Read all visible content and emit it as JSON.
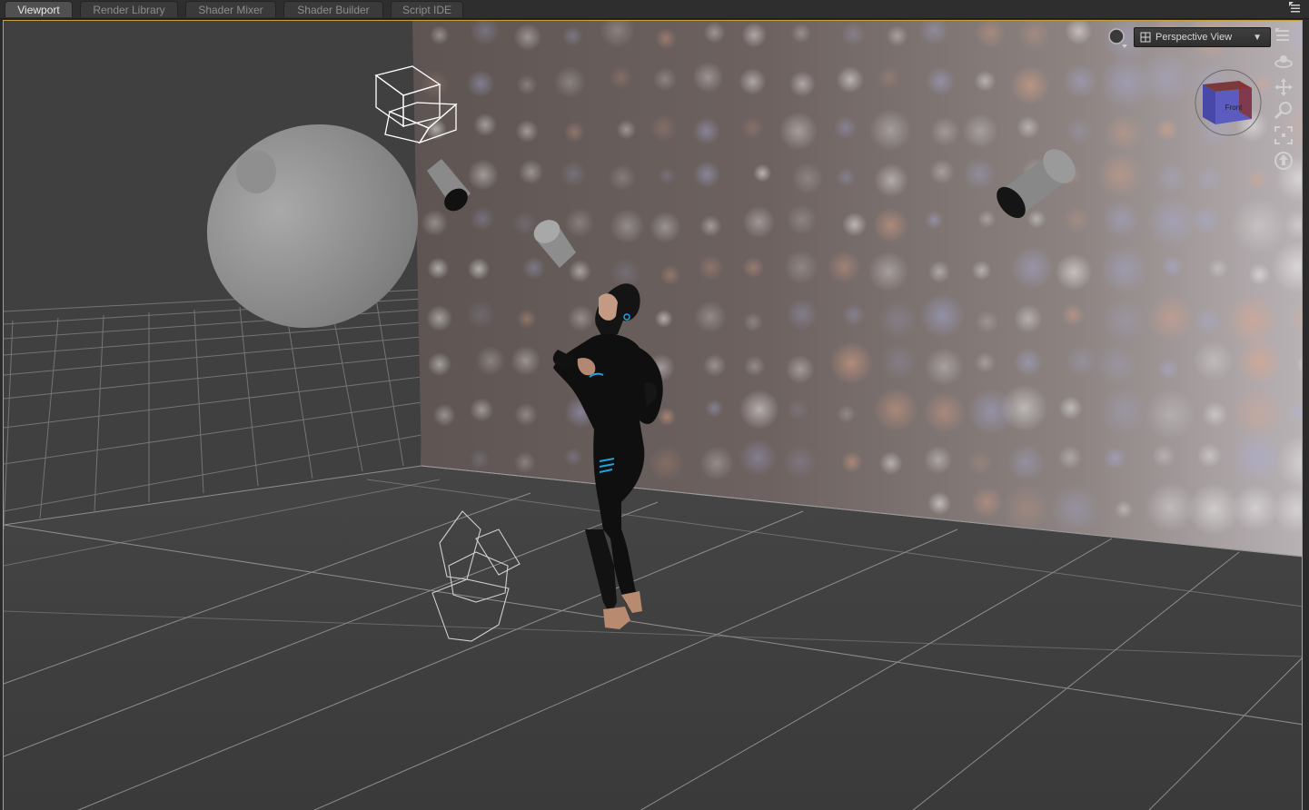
{
  "tabs": [
    {
      "label": "Viewport",
      "active": true
    },
    {
      "label": "Render Library",
      "active": false
    },
    {
      "label": "Shader Mixer",
      "active": false
    },
    {
      "label": "Shader Builder",
      "active": false
    },
    {
      "label": "Script IDE",
      "active": false
    }
  ],
  "viewport": {
    "camera_label": "Perspective View",
    "view_cube_face": "Front",
    "accent_color": "#c9a13a"
  },
  "tools": {
    "render_preview": "sphere-icon",
    "pane_options": "menu-icon",
    "orbit": "orbit-icon",
    "pan": "pan-icon",
    "zoom": "zoom-icon",
    "frame": "frame-icon",
    "reset": "reset-view-icon"
  }
}
